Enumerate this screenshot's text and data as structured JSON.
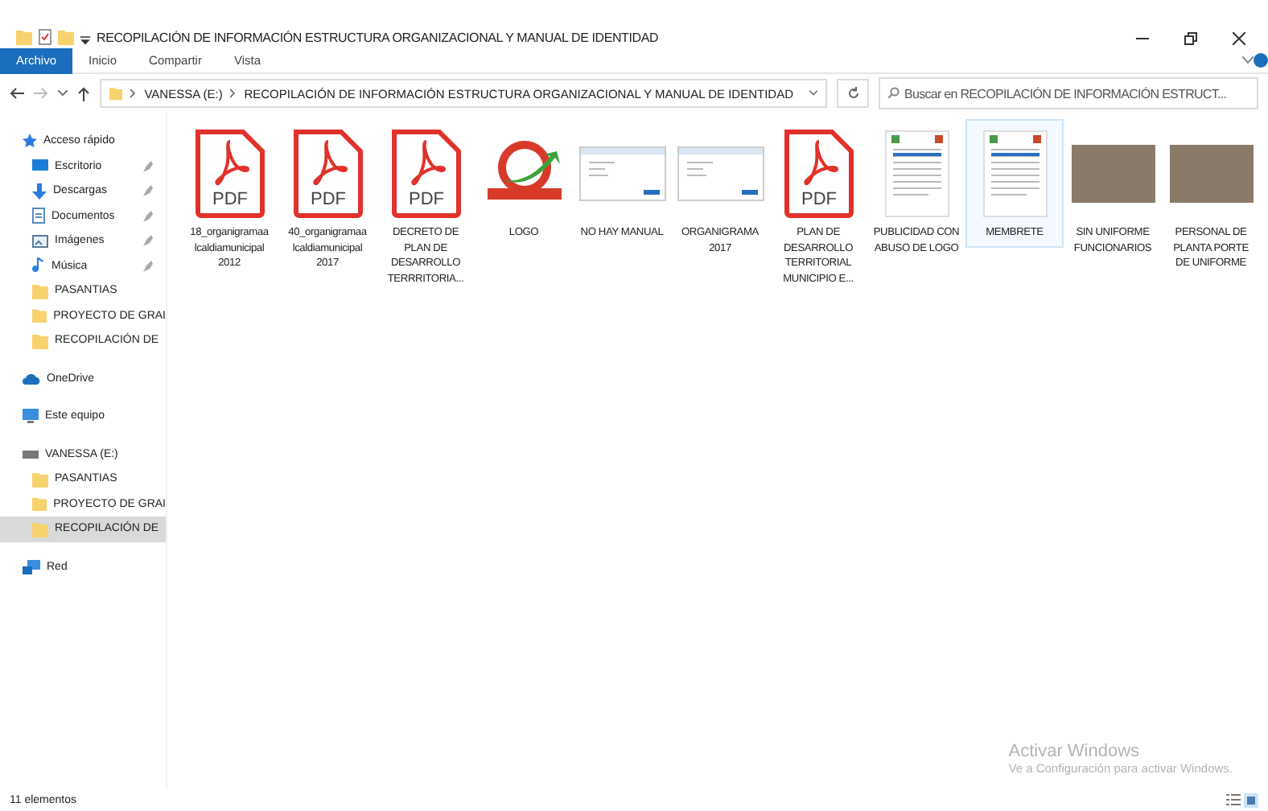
{
  "window": {
    "title": "RECOPILACIÓN DE INFORMACIÓN ESTRUCTURA ORGANIZACIONAL Y MANUAL DE IDENTIDAD"
  },
  "ribbon_tabs": [
    {
      "label": "Archivo",
      "selected": true
    },
    {
      "label": "Inicio",
      "selected": false
    },
    {
      "label": "Compartir",
      "selected": false
    },
    {
      "label": "Vista",
      "selected": false
    }
  ],
  "address_bar": {
    "path": [
      {
        "label": "VANESSA (E:)"
      },
      {
        "label": "RECOPILACIÓN DE INFORMACIÓN ESTRUCTURA ORGANIZACIONAL Y MANUAL DE IDENTIDAD"
      }
    ]
  },
  "search": {
    "placeholder": "Buscar en RECOPILACIÓN DE INFORMACIÓN ESTRUCT..."
  },
  "sidebar": {
    "items": [
      {
        "label": "Acceso rápido",
        "kind": "star",
        "selected": false,
        "children": [
          {
            "label": "Escritorio",
            "kind": "desktop",
            "pinned": true,
            "selected": false
          },
          {
            "label": "Descargas",
            "kind": "download",
            "pinned": true,
            "selected": false
          },
          {
            "label": "Documentos",
            "kind": "document",
            "pinned": true,
            "selected": false
          },
          {
            "label": "Imágenes",
            "kind": "pictures",
            "pinned": true,
            "selected": false
          },
          {
            "label": "Música",
            "kind": "music",
            "pinned": true,
            "selected": false
          },
          {
            "label": "PASANTIAS",
            "kind": "folder",
            "pinned": false,
            "selected": false
          },
          {
            "label": "PROYECTO DE GRAI",
            "kind": "folder",
            "pinned": false,
            "selected": false
          },
          {
            "label": "RECOPILACIÓN DE",
            "kind": "folder",
            "pinned": false,
            "selected": false
          }
        ]
      },
      {
        "label": "OneDrive",
        "kind": "cloud",
        "selected": false
      },
      {
        "label": "Este equipo",
        "kind": "computer",
        "selected": false
      },
      {
        "label": "VANESSA (E:)",
        "kind": "drive",
        "selected": false,
        "children": [
          {
            "label": "PASANTIAS",
            "kind": "folder",
            "pinned": false,
            "selected": false
          },
          {
            "label": "PROYECTO DE GRAI",
            "kind": "folder",
            "pinned": false,
            "selected": false
          },
          {
            "label": "RECOPILACIÓN DE",
            "kind": "folder",
            "pinned": false,
            "selected": true
          }
        ]
      },
      {
        "label": "Red",
        "kind": "network",
        "selected": false
      }
    ]
  },
  "files": [
    {
      "name": "18_organigramaa lcaldiamunicipal 2012",
      "kind": "pdf",
      "badge": "PDF",
      "selected": false
    },
    {
      "name": "40_organigramaa lcaldiamunicipal 2017",
      "kind": "pdf",
      "badge": "PDF",
      "selected": false
    },
    {
      "name": "DECRETO DE PLAN DE DESARROLLO TERRRITORIA...",
      "kind": "pdf",
      "badge": "PDF",
      "selected": false
    },
    {
      "name": "LOGO",
      "kind": "logo",
      "selected": false
    },
    {
      "name": "NO HAY MANUAL",
      "kind": "screenshot",
      "selected": false
    },
    {
      "name": "ORGANIGRAMA 2017",
      "kind": "screenshot",
      "selected": false
    },
    {
      "name": "PLAN DE DESARROLLO TERRITORIAL MUNICIPIO E...",
      "kind": "pdf",
      "badge": "PDF",
      "selected": false
    },
    {
      "name": "PUBLICIDAD CON ABUSO DE LOGO",
      "kind": "document",
      "selected": false
    },
    {
      "name": "MEMBRETE",
      "kind": "document",
      "selected": true
    },
    {
      "name": "SIN UNIFORME FUNCIONARIOS",
      "kind": "photo",
      "selected": false
    },
    {
      "name": "PERSONAL DE PLANTA PORTE DE UNIFORME",
      "kind": "photo",
      "selected": false
    }
  ],
  "activation": {
    "title": "Activar Windows",
    "message": "Ve a Configuración para activar Windows."
  },
  "status_bar": {
    "count": "11 elementos"
  }
}
